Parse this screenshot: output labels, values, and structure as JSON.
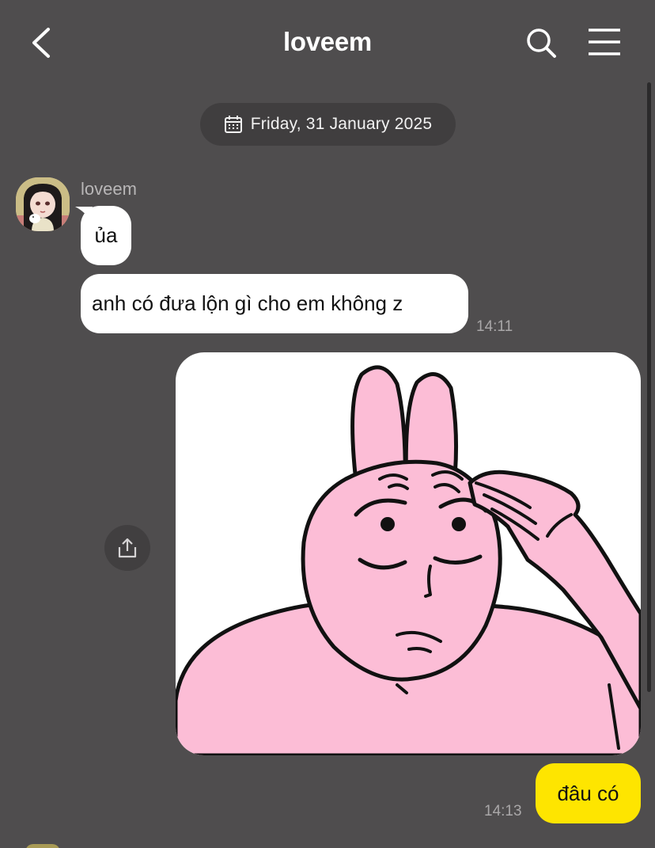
{
  "header": {
    "title": "loveem",
    "back_icon": "chevron-left-icon",
    "search_icon": "search-icon",
    "menu_icon": "hamburger-menu-icon"
  },
  "date_divider": {
    "label": "Friday, 31 January 2025",
    "icon": "calendar-icon"
  },
  "conversation": {
    "incoming": {
      "sender": "loveem",
      "messages": [
        {
          "text": "ủa"
        },
        {
          "text": "anh có đưa lộn gì cho em không z",
          "time": "14:11"
        }
      ]
    },
    "outgoing": {
      "sticker": "pink-rabbit-sticker",
      "share_icon": "share-icon",
      "messages": [
        {
          "text": "đâu có",
          "time": "14:13"
        }
      ]
    }
  },
  "colors": {
    "background": "#4f4d4e",
    "incoming_bubble": "#ffffff",
    "outgoing_bubble": "#fee500",
    "sticker_pink": "#fcbdd6",
    "pill": "#403e3f"
  }
}
